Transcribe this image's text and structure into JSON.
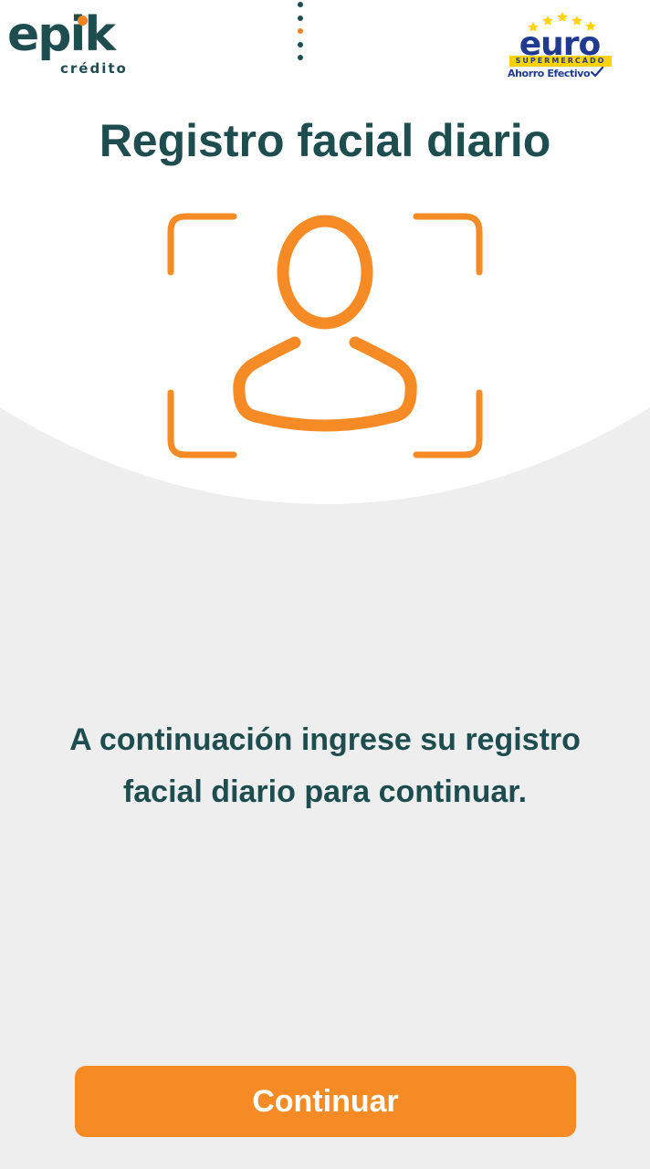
{
  "header": {
    "left_logo": {
      "word": "epik",
      "subtitle": "crédito",
      "icon": "epik-credito-logo"
    },
    "menu_icon": "vertical-dots-menu-icon",
    "right_logo": {
      "word": "euro",
      "band": "SUPERMERCADO",
      "slogan": "Ahorro Efectivo",
      "icon": "euro-supermercado-logo"
    }
  },
  "main": {
    "title": "Registro facial diario",
    "face_icon": "face-scan-icon",
    "instructions": "A continuación ingrese su registro facial diario para continuar."
  },
  "footer": {
    "continue_label": "Continuar"
  },
  "colors": {
    "primary_teal": "#1e4d4f",
    "accent_orange": "#f68b26",
    "background_gray": "#eeeeee",
    "background_white": "#ffffff",
    "euro_blue": "#1f3a8f",
    "euro_yellow": "#ffd200"
  }
}
